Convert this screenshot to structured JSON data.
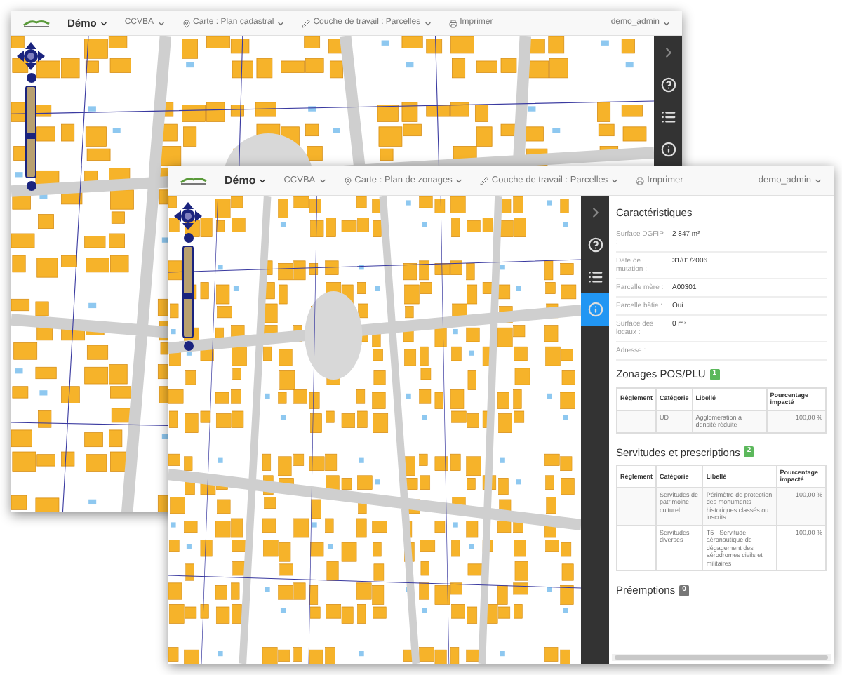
{
  "windows": [
    {
      "navbar": {
        "brand": {
          "label": "Démo",
          "dropdown": true
        },
        "menus": [
          {
            "label": "CCVBA",
            "kind": "plain",
            "dropdown": true
          },
          {
            "label": "Carte : Plan cadastral",
            "kind": "map",
            "dropdown": true
          },
          {
            "label": "Couche de travail : Parcelles",
            "kind": "layer",
            "dropdown": true
          },
          {
            "label": "Imprimer",
            "kind": "print",
            "dropdown": false
          }
        ],
        "user": {
          "label": "demo_admin",
          "dropdown": true
        }
      },
      "zoom_slider": {
        "level": 0.45
      },
      "sidebar": {
        "items": [
          {
            "kind": "collapse",
            "selected": false
          },
          {
            "kind": "help",
            "selected": false
          },
          {
            "kind": "legend",
            "selected": false
          },
          {
            "kind": "info",
            "selected": false
          }
        ]
      }
    },
    {
      "navbar": {
        "brand": {
          "label": "Démo",
          "dropdown": true
        },
        "menus": [
          {
            "label": "CCVBA",
            "kind": "plain",
            "dropdown": true
          },
          {
            "label": "Carte : Plan de zonages",
            "kind": "map",
            "dropdown": true
          },
          {
            "label": "Couche de travail : Parcelles",
            "kind": "layer",
            "dropdown": true
          },
          {
            "label": "Imprimer",
            "kind": "print",
            "dropdown": false
          }
        ],
        "user": {
          "label": "demo_admin",
          "dropdown": true
        }
      },
      "zoom_slider": {
        "level": 0.45
      },
      "sidebar": {
        "items": [
          {
            "kind": "collapse",
            "selected": false
          },
          {
            "kind": "help",
            "selected": false
          },
          {
            "kind": "legend",
            "selected": false
          },
          {
            "kind": "info",
            "selected": true
          }
        ]
      },
      "panel": {
        "title": "Caractéristiques",
        "fields": [
          {
            "label": "Surface DGFIP :",
            "value": "2 847 m²"
          },
          {
            "label": "Date de mutation :",
            "value": "31/01/2006"
          },
          {
            "label": "Parcelle mère :",
            "value": "A00301"
          },
          {
            "label": "Parcelle bâtie :",
            "value": "Oui"
          },
          {
            "label": "Surface des locaux :",
            "value": "0 m²"
          },
          {
            "label": "Adresse :"
          }
        ],
        "sections": [
          {
            "title": "Zonages POS/PLU",
            "count": "1",
            "color": "#5cb85c",
            "columns": [
              "Règlement",
              "Catégorie",
              "Libellé",
              "Pourcentage impacté"
            ],
            "rows": [
              [
                "",
                "UD",
                "Agglomération à densité réduite",
                "100,00 %"
              ]
            ]
          },
          {
            "title": "Servitudes et prescriptions",
            "count": "2",
            "color": "#5cb85c",
            "columns": [
              "Règlement",
              "Catégorie",
              "Libellé",
              "Pourcentage impacté"
            ],
            "rows": [
              [
                "",
                "Servitudes de patrimoine culturel",
                "Périmètre de protection des monuments historiques classés ou inscrits",
                "100,00 %"
              ],
              [
                "",
                "Servitudes diverses",
                "T5 - Servitude aéronautique de dégagement des aérodromes civils et militaires",
                "100,00 %"
              ]
            ]
          },
          {
            "title": "Préemptions",
            "count": "0",
            "color": "#777777"
          }
        ]
      }
    }
  ]
}
